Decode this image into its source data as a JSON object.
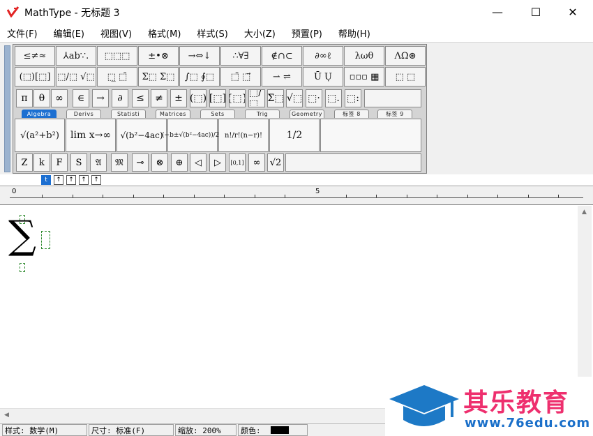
{
  "window": {
    "title": "MathType - 无标题 3",
    "minimize_glyph": "—",
    "maximize_glyph": "☐",
    "close_glyph": "✕"
  },
  "menu": [
    "文件(F)",
    "编辑(E)",
    "视图(V)",
    "格式(M)",
    "样式(S)",
    "大小(Z)",
    "预置(P)",
    "帮助(H)"
  ],
  "palette_row1": [
    "≤≠≈",
    "⅄ab∵.",
    "⬚⬚⬚",
    "±•⊗",
    "→⇔↓",
    "∴∀∃",
    "∉∩⊂",
    "∂∞ℓ",
    "λωθ",
    "ΛΩ⊛"
  ],
  "palette_row2": [
    "(⬚)[⬚]",
    "⬚/⬚ √⬚",
    "⬚̲ ⬚̄",
    "Σ⬚ Σ⬚",
    "∫⬚ ∮⬚",
    "⬚̄ ⬚⃗",
    "⇀ ⇌",
    "Ū Ụ",
    "▫▫▫ ▦",
    "⬚ ⬚"
  ],
  "symbols_row": [
    "π",
    "θ",
    "∞",
    "∈",
    "→",
    "∂",
    "≤",
    "≠",
    "±",
    "(⬚)",
    "[⬚]",
    "{⬚}",
    "⬚/⬚",
    "Σ⬚",
    "√⬚",
    "⬚·",
    "⬚.",
    "⬚:"
  ],
  "tabs": [
    "Algebra",
    "Derivs",
    "Statisti",
    "Matrices",
    "Sets",
    "Trig",
    "Geometry",
    "标签 8",
    "标签 9"
  ],
  "templates": [
    "√(a²+b²)",
    "lim x→∞",
    "√(b²−4ac)",
    "(−b±√(b²−4ac))/2a",
    "n!/r!(n−r)!",
    "1/2"
  ],
  "symbols_row2": [
    "Z",
    "k",
    "F",
    "S",
    "𝔄",
    "𝔐",
    "⊸",
    "⊗",
    "⊕",
    "◁",
    "▷",
    "[0,1]",
    "∞",
    "√2"
  ],
  "small_toolbar": [
    "t",
    "↑",
    "↑",
    "↑",
    "↑"
  ],
  "ruler": {
    "mark0": "0",
    "mark5": "5"
  },
  "editor": {
    "sigma": "∑"
  },
  "status": {
    "style": "样式: 数学(M)",
    "size": "尺寸: 标准(F)",
    "zoom": "缩放: 200%",
    "color": "颜色:"
  },
  "watermark": {
    "name": "其乐教育",
    "url": "www.76edu.com"
  }
}
